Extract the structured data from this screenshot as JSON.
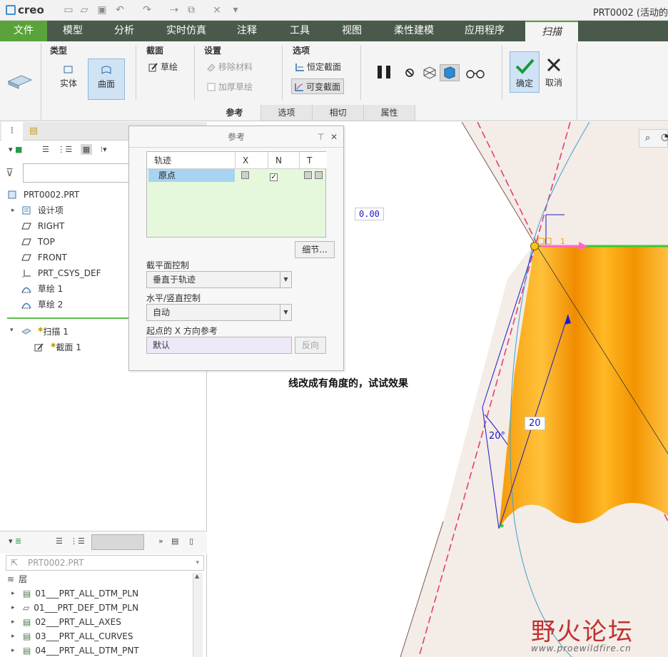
{
  "app": {
    "logo": "creo",
    "window_title": "PRT0002 (活动的"
  },
  "ribbon": {
    "file_tab": "文件",
    "tabs": [
      "模型",
      "分析",
      "实时仿真",
      "注释",
      "工具",
      "视图",
      "柔性建模",
      "应用程序",
      "扫描"
    ],
    "active_tab": "扫描",
    "groups": {
      "type": {
        "title": "类型",
        "solid": "实体",
        "surface": "曲面"
      },
      "section": {
        "title": "截面",
        "sketch": "草绘"
      },
      "settings": {
        "title": "设置",
        "remove_material": "移除材料",
        "thicken_sketch": "加厚草绘"
      },
      "options": {
        "title": "选项",
        "constant_section": "恒定截面",
        "variable_section": "可变截面"
      },
      "ok": "确定",
      "cancel": "取消"
    },
    "subtabs": [
      "参考",
      "选项",
      "相切",
      "属性"
    ],
    "active_subtab": "参考"
  },
  "model_tree": {
    "root": "PRT0002.PRT",
    "items": [
      {
        "label": "设计项",
        "icon": "design-items-icon"
      },
      {
        "label": "RIGHT",
        "icon": "datum-plane-icon"
      },
      {
        "label": "TOP",
        "icon": "datum-plane-icon"
      },
      {
        "label": "FRONT",
        "icon": "datum-plane-icon"
      },
      {
        "label": "PRT_CSYS_DEF",
        "icon": "csys-icon"
      },
      {
        "label": "草绘 1",
        "icon": "sketch-icon"
      },
      {
        "label": "草绘 2",
        "icon": "sketch-icon"
      }
    ],
    "sweep": {
      "label": "扫描 1",
      "child": "截面 1"
    }
  },
  "layers": {
    "selector": "PRT0002.PRT",
    "header": "层",
    "items": [
      "01___PRT_ALL_DTM_PLN",
      "01___PRT_DEF_DTM_PLN",
      "02___PRT_ALL_AXES",
      "03___PRT_ALL_CURVES",
      "04___PRT_ALL_DTM_PNT"
    ]
  },
  "reference_panel": {
    "title": "参考",
    "table": {
      "headers": [
        "轨迹",
        "X",
        "N",
        "T"
      ],
      "rows": [
        {
          "trajectory": "原点",
          "x": false,
          "n": true,
          "t": false
        }
      ]
    },
    "details_button": "细节...",
    "section_plane_control": {
      "label": "截平面控制",
      "value": "垂直于轨迹"
    },
    "hv_control": {
      "label": "水平/竖直控制",
      "value": "自动"
    },
    "x_direction_ref": {
      "label": "起点的 X 方向参考",
      "value": "默认",
      "flip_button": "反向"
    }
  },
  "viewport": {
    "annotation": "线改成有角度的，试试效果",
    "dims": {
      "offset": "0.00",
      "length": "20",
      "angle": "20°",
      "id": "1"
    },
    "colors": {
      "surface_top": "#ffb21a",
      "surface_mid": "#f08a00",
      "datum_line": "#e0407a",
      "trajectory": "#3ca0d0",
      "dim": "#1a1acc",
      "edge_green": "#33cc33"
    }
  },
  "watermark": {
    "chars": "野火论坛",
    "url": "www.proewildfire.cn"
  }
}
